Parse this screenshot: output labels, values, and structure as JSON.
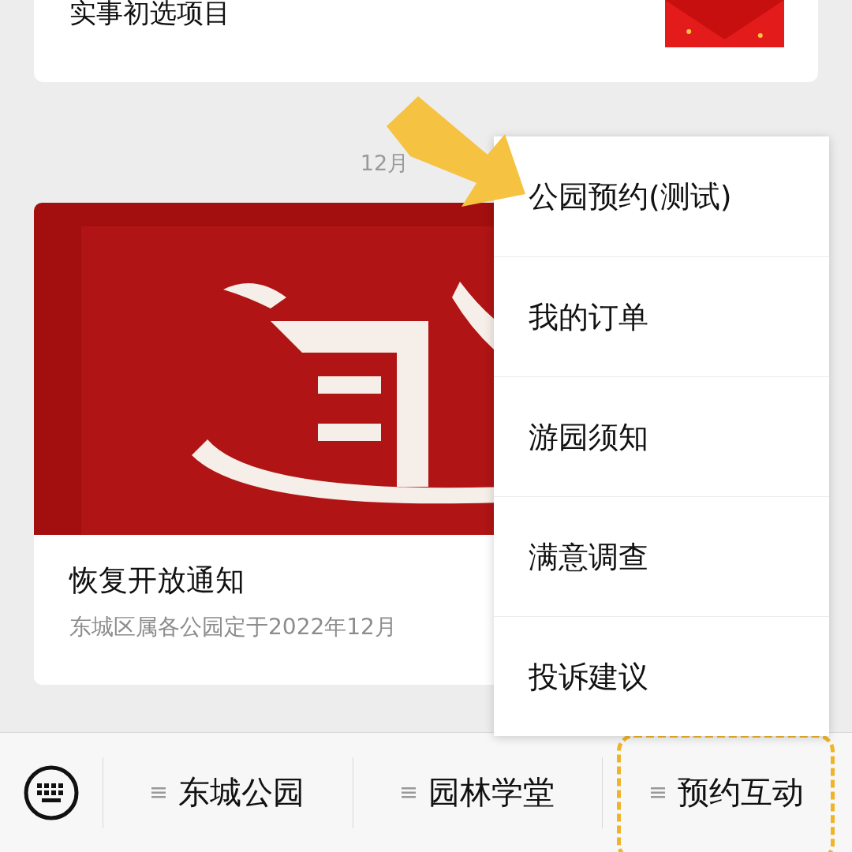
{
  "top_card": {
    "title": "实事初选项目"
  },
  "date_label": "12月",
  "article": {
    "title": "恢复开放通知",
    "summary": "东城区属各公园定于2022年12月"
  },
  "menu": {
    "items": [
      {
        "label": "公园预约(测试)"
      },
      {
        "label": "我的订单"
      },
      {
        "label": "游园须知"
      },
      {
        "label": "满意调查"
      },
      {
        "label": "投诉建议"
      }
    ]
  },
  "bottom_bar": {
    "items": [
      {
        "label": "东城公园",
        "highlighted": false
      },
      {
        "label": "园林学堂",
        "highlighted": false
      },
      {
        "label": "预约互动",
        "highlighted": true
      }
    ]
  }
}
